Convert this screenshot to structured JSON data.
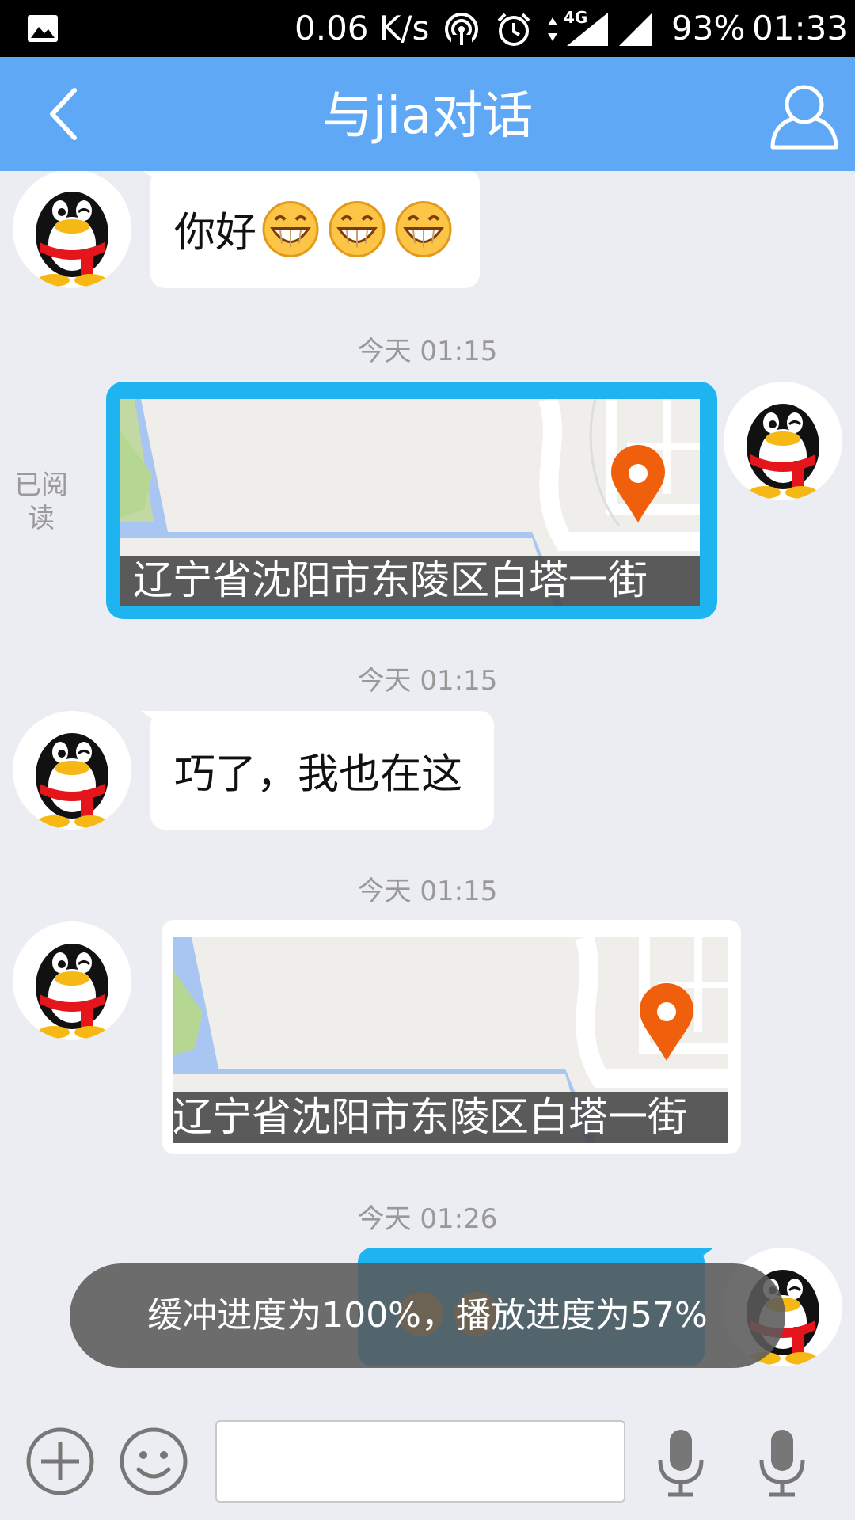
{
  "status_bar": {
    "net_speed": "0.06 K/s",
    "network_type": "4G",
    "battery": "93%",
    "time": "01:33"
  },
  "title_bar": {
    "title": "与jia对话",
    "back_icon": "back-chevron-icon",
    "profile_icon": "person-icon"
  },
  "messages": [
    {
      "side": "left",
      "type": "text",
      "text": "你好",
      "emoji": [
        "grinning-face",
        "grinning-face",
        "grinning-face"
      ]
    },
    {
      "timestamp": "今天 01:15"
    },
    {
      "side": "right",
      "type": "location",
      "read_status": "已阅读",
      "address": "辽宁省沈阳市东陵区白塔一街"
    },
    {
      "timestamp": "今天 01:15"
    },
    {
      "side": "left",
      "type": "text",
      "text": "巧了，我也在这"
    },
    {
      "timestamp": "今天 01:15"
    },
    {
      "side": "left",
      "type": "location",
      "address": "辽宁省沈阳市东陵区白塔一街"
    },
    {
      "timestamp": "今天 01:26"
    },
    {
      "side": "right",
      "type": "voice"
    }
  ],
  "toast": {
    "text": "缓冲进度为100%，播放进度为57%",
    "buffer_progress": 100,
    "play_progress": 57
  },
  "input_bar": {
    "plus_icon": "plus-circle-icon",
    "emoji_icon": "smiley-icon",
    "mic_icons": [
      "microphone-icon",
      "microphone-icon"
    ],
    "input_value": ""
  },
  "colors": {
    "title_bar": "#5ea8f5",
    "self_bubble": "#1eb4f0",
    "background": "#ebedf2",
    "map_pin": "#f0600c"
  }
}
